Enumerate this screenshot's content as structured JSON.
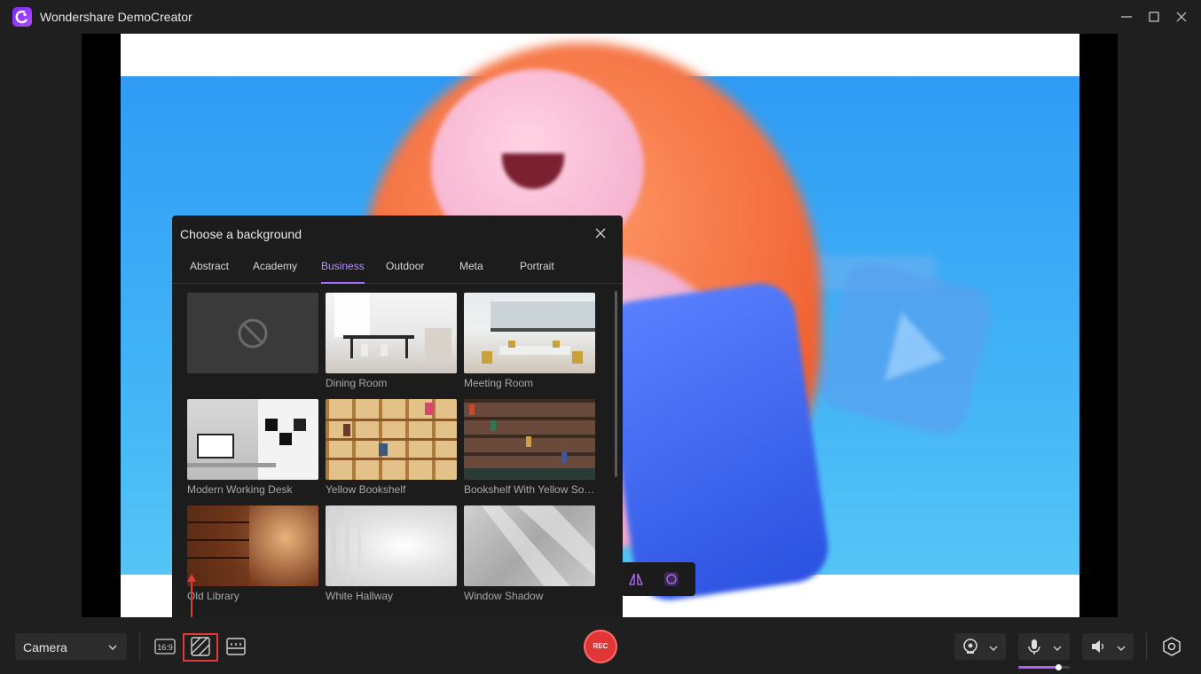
{
  "app": {
    "title": "Wondershare DemoCreator"
  },
  "dialog": {
    "title": "Choose a background",
    "tabs": [
      "Abstract",
      "Academy",
      "Business",
      "Outdoor",
      "Meta",
      "Portrait"
    ],
    "active_tab": "Business",
    "backgrounds": [
      {
        "label": "",
        "icon": "no-background-icon"
      },
      {
        "label": "Dining Room"
      },
      {
        "label": "Meeting Room"
      },
      {
        "label": "Modern Working Desk"
      },
      {
        "label": "Yellow Bookshelf"
      },
      {
        "label": "Bookshelf With Yellow Sof..."
      },
      {
        "label": "Old Library"
      },
      {
        "label": "White Hallway"
      },
      {
        "label": "Window Shadow"
      }
    ]
  },
  "toolbar": {
    "camera_select": "Camera",
    "aspect_ratio": "16:9",
    "record_label": "REC",
    "mic_level": 0.78
  },
  "colors": {
    "accent": "#a56cff",
    "record": "#e03636",
    "highlight": "#e53935"
  }
}
